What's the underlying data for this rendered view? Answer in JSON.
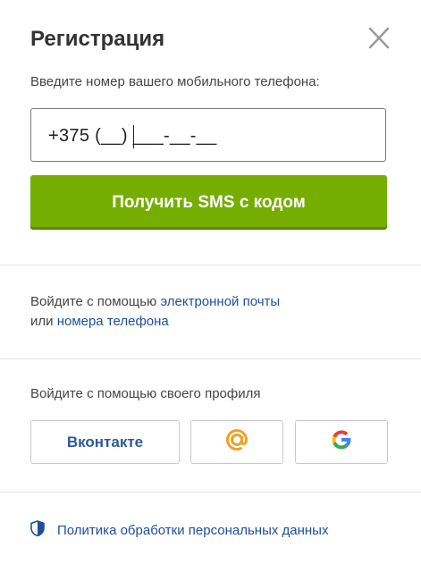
{
  "dialog": {
    "title": "Регистрация",
    "close_icon": "close-icon"
  },
  "phone": {
    "label": "Введите номер вашего мобильного телефона:",
    "value": "+375 (__) ___-__-__",
    "submit_label": "Получить SMS с кодом"
  },
  "alt_login": {
    "prefix": "Войдите с помощью ",
    "email_link": "электронной почты",
    "or_text": "или ",
    "phone_link": "номера телефона"
  },
  "social": {
    "label": "Войдите с помощью своего профиля",
    "vk_label": "Вконтакте",
    "mail_icon": "at-sign-icon",
    "google_icon": "google-icon"
  },
  "privacy": {
    "icon": "shield-icon",
    "link": "Политика обработки персональных данных"
  },
  "colors": {
    "primary_button": "#76ad01",
    "link": "#1d4f9c",
    "vk": "#2d5a9a",
    "mail_at": "#f0a12a"
  }
}
